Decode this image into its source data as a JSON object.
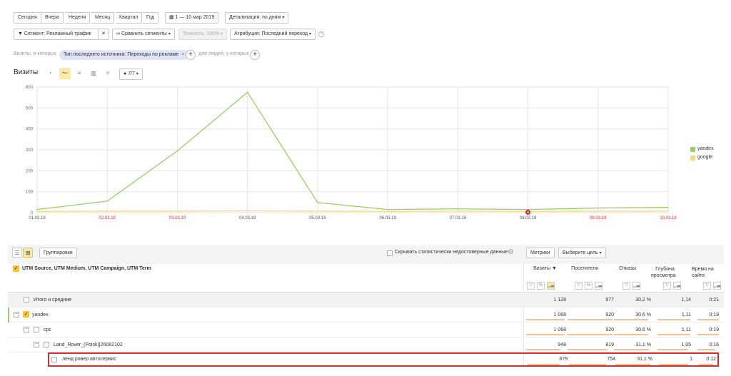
{
  "period": {
    "buttons": [
      "Сегодня",
      "Вчера",
      "Неделя",
      "Месяц",
      "Квартал",
      "Год"
    ],
    "date_range": "1 — 10 мар 2019",
    "detail": "Детализация: по дням"
  },
  "filters": {
    "segment": "Сегмент: Рекламный трафик",
    "compare": "Сравнить сегменты",
    "accuracy": "Точность: 100%",
    "attribution": "Атрибуция: Последний переход",
    "visits_in_which": "Визиты, в которых",
    "condition_pill": "Тип последнего источника: Переходы по рекламе",
    "for_people": "для людей, у которых"
  },
  "chart_header": {
    "title": "Визиты",
    "series_count": "7/7"
  },
  "chart_data": {
    "type": "line",
    "x": [
      "01.03.19",
      "02.03.19",
      "03.03.19",
      "04.03.19",
      "05.03.19",
      "06.03.19",
      "07.03.19",
      "08.03.19",
      "09.03.19",
      "10.03.19"
    ],
    "weekend_x": [
      "02.03.19",
      "03.03.19",
      "09.03.19",
      "10.03.19"
    ],
    "ylim": [
      0,
      600
    ],
    "yticks": [
      0,
      100,
      200,
      300,
      400,
      500,
      600
    ],
    "series": [
      {
        "name": "yandex",
        "color": "#9ccc65",
        "values": [
          15,
          55,
          295,
          575,
          48,
          15,
          18,
          15,
          22,
          25
        ]
      },
      {
        "name": "google",
        "color": "#f7d774",
        "values": [
          6,
          7,
          7,
          8,
          7,
          6,
          7,
          6,
          7,
          7
        ]
      }
    ],
    "marker_x": "08.03.19",
    "marker_color": "#d32f2f"
  },
  "table": {
    "groupings_btn": "Группировки",
    "hide_unreliable": "Скрывать статистически недостоверные данные",
    "metrics_btn": "Метрики",
    "goal_btn": "Выберите цель",
    "dims_title": "UTM Source, UTM Medium, UTM Campaign, UTM Term",
    "columns": [
      {
        "label": "Визиты",
        "sort": "▼"
      },
      {
        "label": "Посетители"
      },
      {
        "label": "Отказы"
      },
      {
        "label": "Глубина просмотра"
      },
      {
        "label": "Время на сайте"
      }
    ],
    "rows": [
      {
        "name": "Итого и средние",
        "values": [
          "1 128",
          "977",
          "30,2 %",
          "1,14",
          "0:21"
        ]
      },
      {
        "name": "yandex",
        "values": [
          "1 068",
          "920",
          "30,6 %",
          "1,11",
          "0:19"
        ]
      },
      {
        "name": "cpc",
        "values": [
          "1 068",
          "920",
          "30,6 %",
          "1,11",
          "0:19"
        ]
      },
      {
        "name": "Land_Rover_(Poisk)|26082102",
        "values": [
          "948",
          "819",
          "31,1 %",
          "1,05",
          "0:16"
        ]
      },
      {
        "name": "ленд ровер автосервис",
        "values": [
          "879",
          "754",
          "31,1 %",
          "1",
          "0:12"
        ]
      }
    ]
  }
}
